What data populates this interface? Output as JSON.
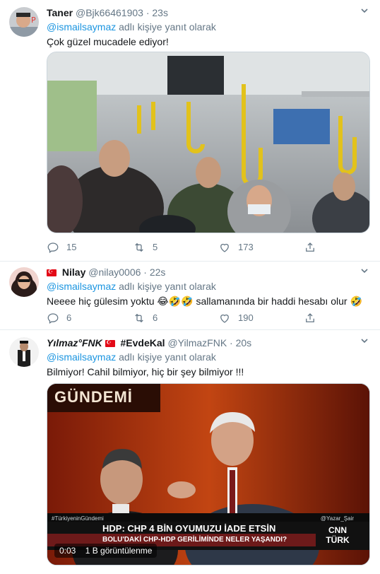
{
  "tweets": [
    {
      "name": "Taner",
      "handle": "@Bjk66461903",
      "separator": "·",
      "time": "23s",
      "reply_mention": "@ismailsaymaz",
      "reply_suffix": " adlı kişiye yanıt olarak",
      "text": "Çok güzel mucadele ediyor!",
      "replies": "15",
      "retweets": "5",
      "likes": "173"
    },
    {
      "name": "Nilay",
      "handle": "@nilay0006",
      "separator": "·",
      "time": "22s",
      "reply_mention": "@ismailsaymaz",
      "reply_suffix": " adlı kişiye yanıt olarak",
      "text": "Neeee hiç gülesim yoktu 😂🤣🤣 sallamanında bir haddi hesabı olur 🤣",
      "replies": "6",
      "retweets": "6",
      "likes": "190"
    },
    {
      "name": "Yılmaz°FNK",
      "name_tag": "#EvdeKal",
      "handle": "@YilmazFNK",
      "separator": "·",
      "time": "20s",
      "reply_mention": "@ismailsaymaz",
      "reply_suffix": " adlı kişiye yanıt olarak",
      "text": "Bilmiyor! Cahil bilmiyor, hiç bir şey bilmiyor !!!",
      "video": {
        "banner": "GÜNDEMİ",
        "headline": "HDP: CHP 4 BİN OYUMUZU İADE ETSİN",
        "subline": "BOLU'DAKİ CHP-HDP GERİLİMİNDE NELER YAŞANDI?",
        "channel": "CNN TÜRK",
        "hashtag": "#TürkiyeninGündemi",
        "watermark": "@Yazar_Şair",
        "duration": "0:03",
        "views": "1 B görüntülenme"
      }
    }
  ],
  "colors": {
    "link": "#1b95e0",
    "muted": "#657786",
    "border": "#e6ecf0"
  }
}
